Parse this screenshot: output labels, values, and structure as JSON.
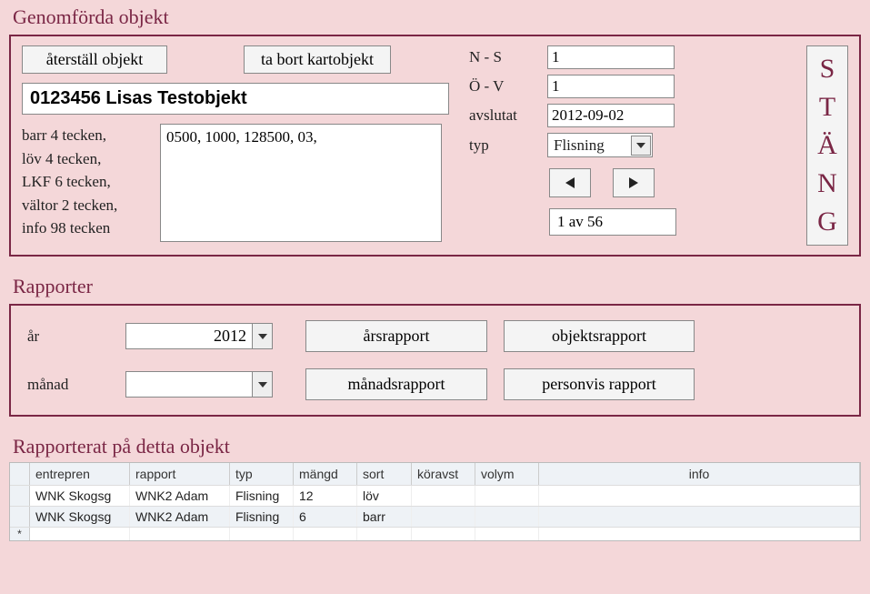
{
  "section1_title": "Genomförda objekt",
  "section2_title": "Rapporter",
  "section3_title": "Rapporterat på detta objekt",
  "buttons": {
    "reset": "återställ objekt",
    "delete": "ta bort kartobjekt",
    "close_letters": [
      "S",
      "T",
      "Ä",
      "N",
      "G"
    ],
    "year_report": "årsrapport",
    "object_report": "objektsrapport",
    "month_report": "månadsrapport",
    "person_report": "personvis rapport"
  },
  "object_name": "0123456 Lisas Testobjekt",
  "hints": [
    "barr 4 tecken,",
    "löv 4 tecken,",
    "LKF 6 tecken,",
    "vältor 2 tecken,",
    "info 98 tecken"
  ],
  "textarea_value": "0500, 1000, 128500, 03,",
  "fields": {
    "ns_label": "N - S",
    "ns_value": "1",
    "ov_label": "Ö - V",
    "ov_value": "1",
    "finished_label": "avslutat",
    "finished_value": "2012-09-02",
    "type_label": "typ",
    "type_value": "Flisning",
    "counter": "1 av 56"
  },
  "reports": {
    "year_label": "år",
    "year_value": "2012",
    "month_label": "månad",
    "month_value": ""
  },
  "table": {
    "headers": [
      "entrepren",
      "rapport",
      "typ",
      "mängd",
      "sort",
      "köravst",
      "volym",
      "info"
    ],
    "rows": [
      {
        "entrepren": "WNK Skogsg",
        "rapport": "WNK2 Adam",
        "typ": "Flisning",
        "mangd": "12",
        "sort": "löv",
        "koravst": "",
        "volym": "",
        "info": ""
      },
      {
        "entrepren": "WNK Skogsg",
        "rapport": "WNK2 Adam",
        "typ": "Flisning",
        "mangd": "6",
        "sort": "barr",
        "koravst": "",
        "volym": "",
        "info": ""
      }
    ]
  }
}
